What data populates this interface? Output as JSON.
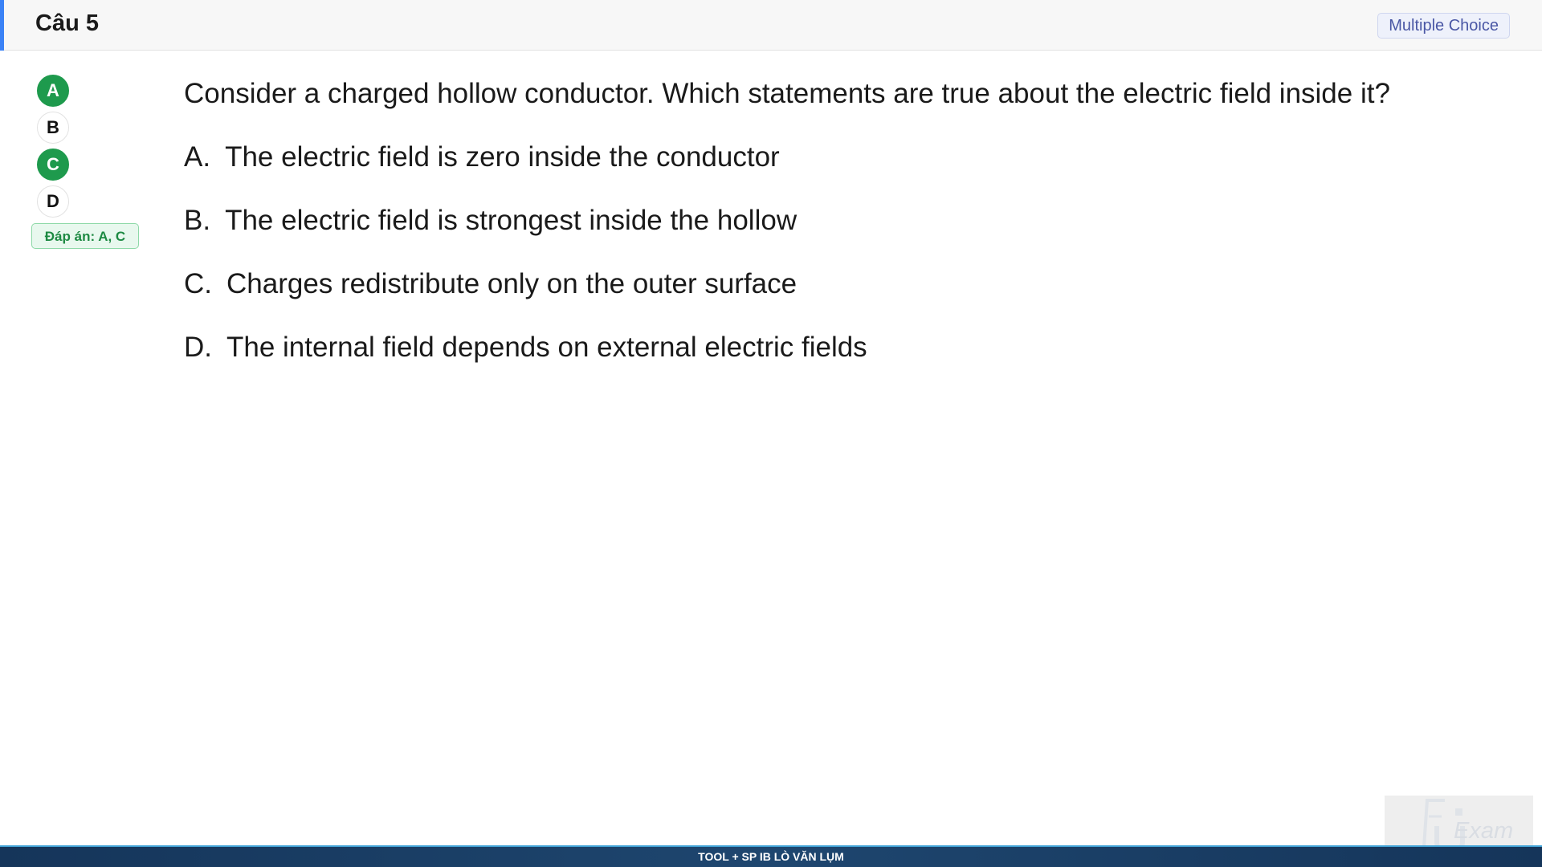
{
  "header": {
    "title": "Câu 5",
    "question_type": "Multiple Choice"
  },
  "answer_selector": {
    "options": [
      {
        "label": "A",
        "selected": true
      },
      {
        "label": "B",
        "selected": false
      },
      {
        "label": "C",
        "selected": true
      },
      {
        "label": "D",
        "selected": false
      }
    ],
    "correct_answer_text": "Đáp án: A, C"
  },
  "question": {
    "text": "Consider a charged hollow conductor. Which statements are true about the electric field inside it?",
    "options": [
      {
        "letter": "A.",
        "text": "The electric field is zero inside the conductor"
      },
      {
        "letter": "B.",
        "text": "The electric field is strongest inside the hollow"
      },
      {
        "letter": "C.",
        "text": "Charges redistribute only on the outer surface"
      },
      {
        "letter": "D.",
        "text": "The internal field depends on external electric fields"
      }
    ]
  },
  "footer": {
    "text": "TOOL + SP IB LÒ VĂN LỤM"
  },
  "logo": {
    "text": "Exam",
    "icon": "fu-logo-icon"
  },
  "colors": {
    "selected_green": "#1e9a4d",
    "header_accent": "#3b82f6",
    "footer_bg": "#1e466f"
  }
}
